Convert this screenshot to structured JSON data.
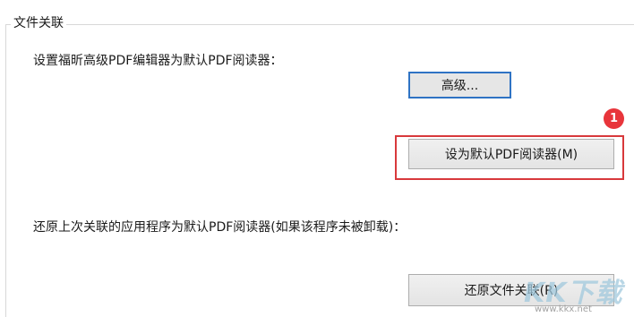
{
  "group": {
    "title": "文件关联"
  },
  "set_default": {
    "description": "设置福昕高级PDF编辑器为默认PDF阅读器：",
    "advanced_button": "高级...",
    "default_button": "设为默认PDF阅读器(M)"
  },
  "restore": {
    "description": "还原上次关联的应用程序为默认PDF阅读器(如果该程序未被卸载)：",
    "button": "还原文件关联(R)"
  },
  "annotation": {
    "badge_number": "1",
    "highlight_color": "#d8393c",
    "badge_color": "#e8353b"
  },
  "watermark": {
    "logo_text": "KK下载",
    "url": "www.kkx.net"
  }
}
